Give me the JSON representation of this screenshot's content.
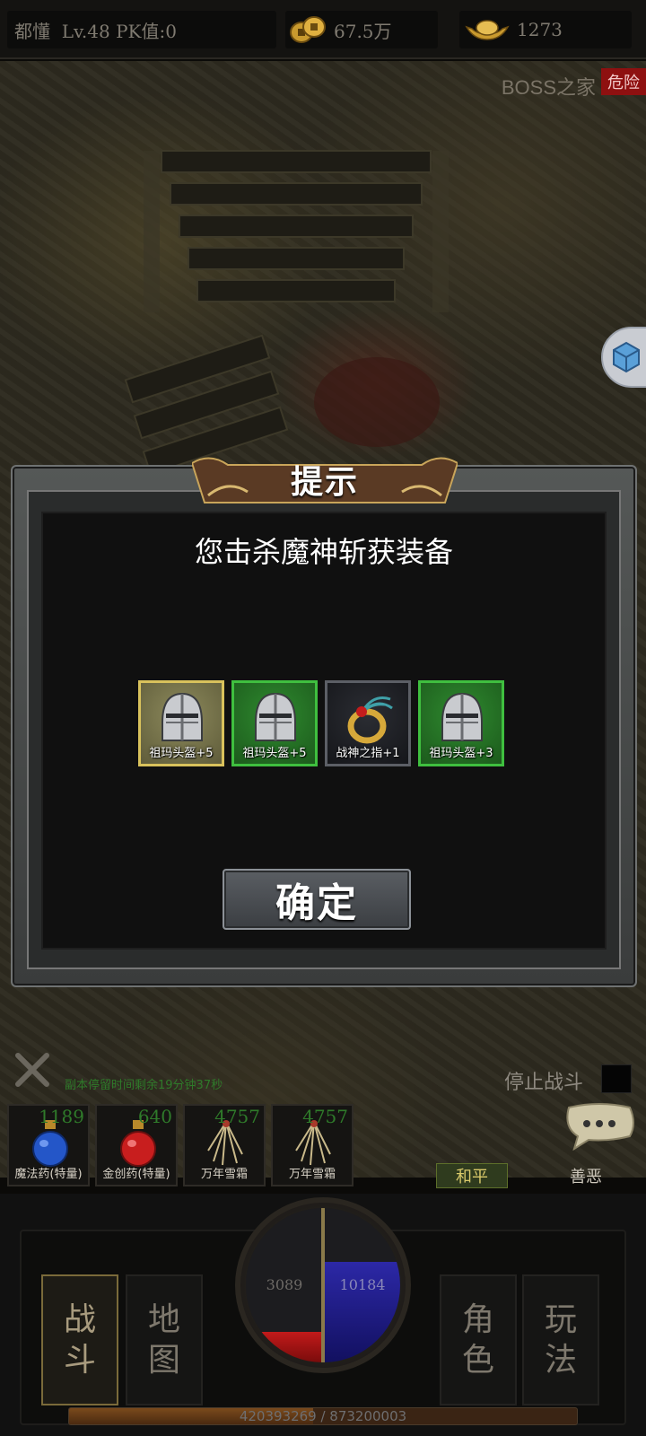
{
  "status_bar": {
    "player": "都懂  Lv.48 PK值:0",
    "gold": "67.5万",
    "ingot": "1273"
  },
  "scene": {
    "zone_label": "BOSS之家",
    "danger_badge": "危险"
  },
  "modal": {
    "title": "提示",
    "message": "您击杀魔神斩获装备",
    "drops": [
      {
        "label": "祖玛头盔+5",
        "frame": "gold",
        "icon": "helmet-icon"
      },
      {
        "label": "祖玛头盔+5",
        "frame": "green",
        "icon": "helmet-icon"
      },
      {
        "label": "战神之指+1",
        "frame": "dark",
        "icon": "ring-icon"
      },
      {
        "label": "祖玛头盔+3",
        "frame": "green",
        "icon": "helmet-icon"
      }
    ],
    "confirm_label": "确定"
  },
  "hud": {
    "instance_timer": "副本停留时间剩余19分钟37秒",
    "stop_battle": "停止战斗",
    "peace_label": "和平",
    "good_evil_label": "善恶",
    "quick_slots": [
      {
        "count": "1189",
        "label": "魔法药(特量)",
        "icon": "blue-potion-icon"
      },
      {
        "count": "640",
        "label": "金创药(特量)",
        "icon": "red-potion-icon"
      },
      {
        "count": "4757",
        "label": "万年雪霜",
        "icon": "snow-frost-icon"
      },
      {
        "count": "4757",
        "label": "万年雪霜",
        "icon": "snow-frost-icon"
      }
    ]
  },
  "bottom": {
    "nav": [
      {
        "line1": "战",
        "line2": "斗",
        "active": true
      },
      {
        "line1": "地",
        "line2": "图",
        "active": false
      },
      {
        "line1": "角",
        "line2": "色",
        "active": false
      },
      {
        "line1": "玩",
        "line2": "法",
        "active": false
      }
    ],
    "hp": "3089",
    "mp": "10184",
    "hp_fill_fraction": 0.2,
    "mp_fill_fraction": 0.65,
    "exp_text": "420393269 / 873200003",
    "exp_fraction": 0.48
  },
  "colors": {
    "rarity_gold": "#d9c25c",
    "rarity_green": "#3fbf3f",
    "danger": "#8e1010",
    "hp": "#c21a1a",
    "mp": "#2c28a6"
  }
}
